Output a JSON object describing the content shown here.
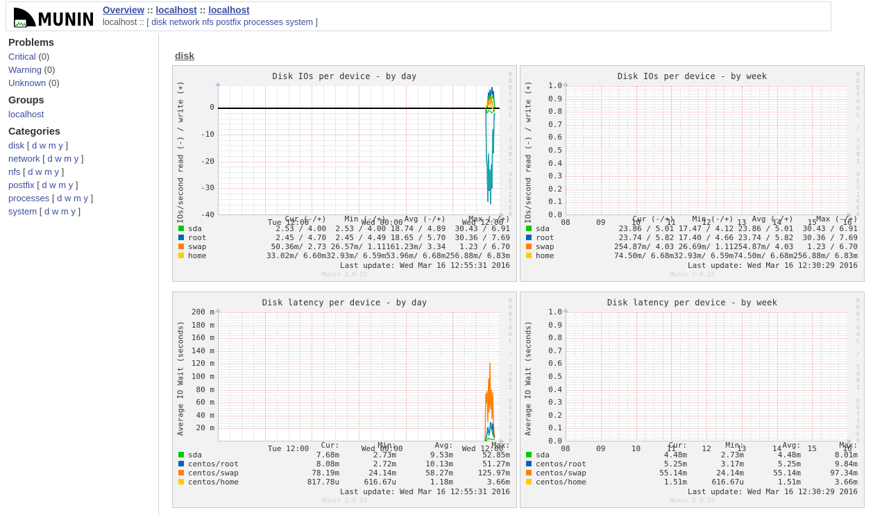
{
  "header": {
    "logo_alt": "MUNIN",
    "title_parts": [
      "Overview",
      "localhost",
      "localhost"
    ],
    "title_separator": " :: ",
    "subline_host": "localhost",
    "subline_separator": " :: ",
    "subline_open": "[",
    "subline_close": "]",
    "categories": [
      "disk",
      "network",
      "nfs",
      "postfix",
      "processes",
      "system"
    ]
  },
  "sidebar": {
    "problems": {
      "heading": "Problems",
      "items": [
        {
          "label": "Critical",
          "count": "(0)"
        },
        {
          "label": "Warning",
          "count": "(0)"
        },
        {
          "label": "Unknown",
          "count": "(0)"
        }
      ]
    },
    "groups": {
      "heading": "Groups",
      "items": [
        {
          "label": "localhost"
        }
      ]
    },
    "categories": {
      "heading": "Categories",
      "period_open": "[",
      "period_close": "]",
      "periods": [
        "d",
        "w",
        "m",
        "y"
      ],
      "items": [
        {
          "label": "disk"
        },
        {
          "label": "network"
        },
        {
          "label": "nfs"
        },
        {
          "label": "postfix"
        },
        {
          "label": "processes"
        },
        {
          "label": "system"
        }
      ]
    }
  },
  "content": {
    "category_heading": "disk",
    "munin_version": "Munin 2.0.25",
    "watermark": "RRDTOOL / TOBI OETIKER"
  },
  "chart_data": [
    {
      "id": "disk-ios-day",
      "type": "line",
      "title": "Disk IOs per device - by day",
      "ylabel": "IOs/second read (-) / write (+)",
      "xlabel": "",
      "ylim": [
        -40,
        8
      ],
      "yticks": [
        0,
        -10,
        -20,
        -30,
        -40
      ],
      "ytick_labels": [
        "0",
        "-10",
        "-20",
        "-30",
        "-40"
      ],
      "xticks": [
        "Tue 12:00",
        "Wed 00:00",
        "Wed 12:00"
      ],
      "grid": true,
      "legend_position": "below",
      "zero_line": true,
      "columns": [
        "Cur (-/+)",
        "Min (-/+)",
        "Avg (-/+)",
        "Max (-/+)"
      ],
      "series": [
        {
          "name": "sda",
          "color": "#00cc00",
          "cur": "2.53 /  4.00",
          "min": "2.53 /  4.00",
          "avg": "18.74 /  4.89",
          "max": "30.43 /  6.91"
        },
        {
          "name": "root",
          "color": "#0066b3",
          "cur": "2.45 /  4.70",
          "min": "2.45 /  4.49",
          "avg": "18.65 /  5.70",
          "max": "30.36 /  7.69"
        },
        {
          "name": "swap",
          "color": "#ff8000",
          "cur": "50.36m/  2.73",
          "min": "26.57m/  1.11",
          "avg": "161.23m/  3.34",
          "max": "1.23 /  6.70"
        },
        {
          "name": "home",
          "color": "#ffcc00",
          "cur": "33.02m/  6.60m",
          "min": "32.93m/  6.59m",
          "avg": "53.96m/  6.68m",
          "max": "256.88m/  6.83m"
        }
      ],
      "last_update": "Last update: Wed Mar 16 12:55:31 2016"
    },
    {
      "id": "disk-ios-week",
      "type": "line",
      "title": "Disk IOs per device - by week",
      "ylabel": "IOs/second read (-) / write (+)",
      "xlabel": "",
      "ylim": [
        0,
        1
      ],
      "yticks": [
        1.0,
        0.9,
        0.8,
        0.7,
        0.6,
        0.5,
        0.4,
        0.3,
        0.2,
        0.1,
        0.0
      ],
      "ytick_labels": [
        "1.0",
        "0.9",
        "0.8",
        "0.7",
        "0.6",
        "0.5",
        "0.4",
        "0.3",
        "0.2",
        "0.1",
        "0.0"
      ],
      "xticks": [
        "08",
        "09",
        "10",
        "11",
        "12",
        "13",
        "14",
        "15",
        "16"
      ],
      "grid": true,
      "legend_position": "below",
      "zero_line": false,
      "columns": [
        "Cur (-/+)",
        "Min (-/+)",
        "Avg (-/+)",
        "Max (-/+)"
      ],
      "series": [
        {
          "name": "sda",
          "color": "#00cc00",
          "cur": "23.86 /  5.01",
          "min": "17.47 /  4.12",
          "avg": "23.86 /  5.01",
          "max": "30.43 /  6.91"
        },
        {
          "name": "root",
          "color": "#0066b3",
          "cur": "23.74 /  5.82",
          "min": "17.40 /  4.66",
          "avg": "23.74 /  5.82",
          "max": "30.36 /  7.69"
        },
        {
          "name": "swap",
          "color": "#ff8000",
          "cur": "254.87m/  4.03",
          "min": "26.69m/  1.11",
          "avg": "254.87m/  4.03",
          "max": "1.23 /  6.70"
        },
        {
          "name": "home",
          "color": "#ffcc00",
          "cur": "74.50m/  6.68m",
          "min": "32.93m/  6.59m",
          "avg": "74.50m/  6.68m",
          "max": "256.88m/  6.83m"
        }
      ],
      "last_update": "Last update: Wed Mar 16 12:30:29 2016"
    },
    {
      "id": "disk-latency-day",
      "type": "line",
      "title": "Disk latency per device - by day",
      "ylabel": "Average IO Wait (seconds)",
      "xlabel": "",
      "ylim": [
        0,
        0.2
      ],
      "yticks": [
        0.2,
        0.18,
        0.16,
        0.14,
        0.12,
        0.1,
        0.08,
        0.06,
        0.04,
        0.02
      ],
      "ytick_labels": [
        "200 m",
        "180 m",
        "160 m",
        "140 m",
        "120 m",
        "100 m",
        "80 m",
        "60 m",
        "40 m",
        "20 m"
      ],
      "xticks": [
        "Tue 12:00",
        "Wed 00:00",
        "Wed 12:00"
      ],
      "grid": true,
      "legend_position": "below",
      "zero_line": false,
      "columns": [
        "Cur:",
        "Min:",
        "Avg:",
        "Max:"
      ],
      "series": [
        {
          "name": "sda",
          "color": "#00cc00",
          "cur": "7.68m",
          "min": "2.73m",
          "avg": "9.53m",
          "max": "52.85m"
        },
        {
          "name": "centos/root",
          "color": "#0066b3",
          "cur": "8.08m",
          "min": "2.72m",
          "avg": "10.13m",
          "max": "51.27m"
        },
        {
          "name": "centos/swap",
          "color": "#ff8000",
          "cur": "78.19m",
          "min": "24.14m",
          "avg": "58.27m",
          "max": "125.97m"
        },
        {
          "name": "centos/home",
          "color": "#ffcc00",
          "cur": "817.78u",
          "min": "616.67u",
          "avg": "1.18m",
          "max": "3.66m"
        }
      ],
      "last_update": "Last update: Wed Mar 16 12:55:31 2016"
    },
    {
      "id": "disk-latency-week",
      "type": "line",
      "title": "Disk latency per device - by week",
      "ylabel": "Average IO Wait (seconds)",
      "xlabel": "",
      "ylim": [
        0,
        1
      ],
      "yticks": [
        1.0,
        0.9,
        0.8,
        0.7,
        0.6,
        0.5,
        0.4,
        0.3,
        0.2,
        0.1,
        0.0
      ],
      "ytick_labels": [
        "1.0",
        "0.9",
        "0.8",
        "0.7",
        "0.6",
        "0.5",
        "0.4",
        "0.3",
        "0.2",
        "0.1",
        "0.0"
      ],
      "xticks": [
        "08",
        "09",
        "10",
        "11",
        "12",
        "13",
        "14",
        "15",
        "16"
      ],
      "grid": true,
      "legend_position": "below",
      "zero_line": false,
      "columns": [
        "Cur:",
        "Min:",
        "Avg:",
        "Max:"
      ],
      "series": [
        {
          "name": "sda",
          "color": "#00cc00",
          "cur": "4.48m",
          "min": "2.73m",
          "avg": "4.48m",
          "max": "8.01m"
        },
        {
          "name": "centos/root",
          "color": "#0066b3",
          "cur": "5.25m",
          "min": "3.17m",
          "avg": "5.25m",
          "max": "9.84m"
        },
        {
          "name": "centos/swap",
          "color": "#ff8000",
          "cur": "55.14m",
          "min": "24.14m",
          "avg": "55.14m",
          "max": "97.34m"
        },
        {
          "name": "centos/home",
          "color": "#ffcc00",
          "cur": "1.51m",
          "min": "616.67u",
          "avg": "1.51m",
          "max": "3.66m"
        }
      ],
      "last_update": "Last update: Wed Mar 16 12:30:29 2016"
    }
  ]
}
